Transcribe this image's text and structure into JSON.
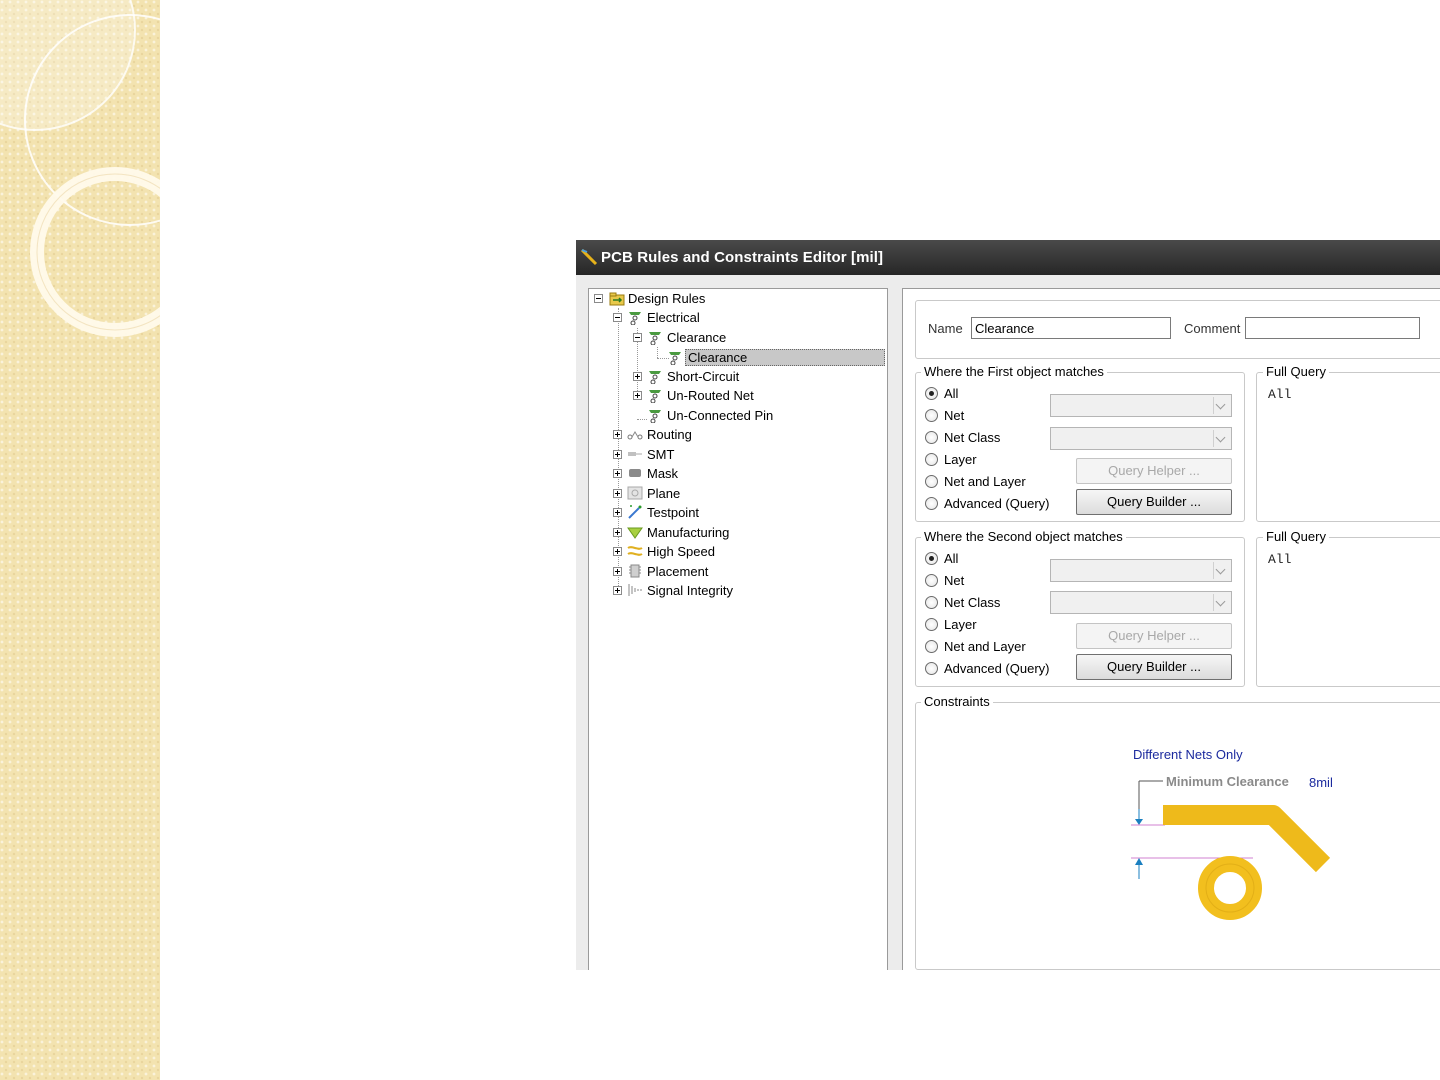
{
  "window": {
    "title": "PCB Rules and Constraints Editor [mil]"
  },
  "tree": {
    "root": "Design Rules",
    "electrical": "Electrical",
    "clearance_group": "Clearance",
    "clearance_rule": "Clearance",
    "short_circuit": "Short-Circuit",
    "unrouted_net": "Un-Routed Net",
    "unconnected_pin": "Un-Connected Pin",
    "categories": [
      "Routing",
      "SMT",
      "Mask",
      "Plane",
      "Testpoint",
      "Manufacturing",
      "High Speed",
      "Placement",
      "Signal Integrity"
    ]
  },
  "rule": {
    "name_label": "Name",
    "name_value": "Clearance",
    "comment_label": "Comment",
    "comment_value": ""
  },
  "first_match": {
    "title": "Where the First object matches",
    "options": [
      "All",
      "Net",
      "Net Class",
      "Layer",
      "Net and Layer",
      "Advanced (Query)"
    ],
    "selected": "All",
    "query_helper": "Query Helper ...",
    "query_builder": "Query Builder ...",
    "full_query_title": "Full Query",
    "full_query": "All"
  },
  "second_match": {
    "title": "Where the Second object matches",
    "options": [
      "All",
      "Net",
      "Net Class",
      "Layer",
      "Net and Layer",
      "Advanced (Query)"
    ],
    "selected": "All",
    "query_helper": "Query Helper ...",
    "query_builder": "Query Builder ...",
    "full_query_title": "Full Query",
    "full_query": "All"
  },
  "constraints": {
    "title": "Constraints",
    "net_scope": "Different Nets Only",
    "min_clearance_label": "Minimum Clearance",
    "min_clearance_value": "8mil"
  },
  "colors": {
    "trace": "#f2bf1e",
    "trace_edge": "#d4a010",
    "scope_text": "#1b2a9e",
    "arrow": "#1a7fc0"
  }
}
